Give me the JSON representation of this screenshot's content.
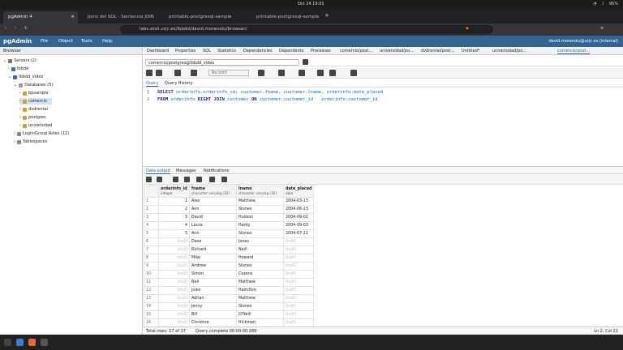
{
  "system": {
    "clock": "Oct 24  19:01",
    "battery": "95%"
  },
  "browser_tabs": [
    {
      "title": "pgAdmin 4",
      "active": true
    },
    {
      "title": "Joins del SQL - Sentencia JOIN",
      "active": false
    },
    {
      "title": "printable-postgresql-sample",
      "active": false
    },
    {
      "title": "printable-postgresql-sample",
      "active": false
    }
  ],
  "address": {
    "url": "labs.etsii.urjc.es/lbbdd/david.morenolu/browser/"
  },
  "app": {
    "logo": "pgAdmin",
    "menu": [
      "File",
      "Object",
      "Tools",
      "Help"
    ],
    "user": "david.morenolu@urjc.es (internal)"
  },
  "browser_panel": {
    "title": "Browser",
    "tree": [
      {
        "label": "Servers (2)",
        "level": 0
      },
      {
        "label": "lbbdd",
        "level": 1
      },
      {
        "label": "lbbdd_video",
        "level": 1
      },
      {
        "label": "Databases (5)",
        "level": 2
      },
      {
        "label": "bpsample",
        "level": 3
      },
      {
        "label": "comercio",
        "level": 3,
        "selected": true
      },
      {
        "label": "dvdrental",
        "level": 3
      },
      {
        "label": "postgres",
        "level": 3
      },
      {
        "label": "universidad",
        "level": 3
      },
      {
        "label": "Login/Group Roles (12)",
        "level": 2
      },
      {
        "label": "Tablespaces",
        "level": 2
      }
    ]
  },
  "panel_tabs": [
    "Dashboard",
    "Properties",
    "SQL",
    "Statistics",
    "Dependencies",
    "Dependents",
    "Processes",
    "comercio/post...",
    "universidad/po...",
    "dvdrental/post...",
    "Untitled*",
    "universidad/po...",
    "comercio/post..."
  ],
  "connection": "comercio/postgres@lbbdd_video",
  "toolbar": {
    "limit": "No limit"
  },
  "query_tabs": [
    "Query",
    "Query History"
  ],
  "editor": {
    "line1": {
      "num": "1",
      "kw1": "SELECT",
      "rest": " orderinfo.orderinfo_id, customer.fname, customer.lname, orderinfo.date_placed"
    },
    "line2": {
      "num": "2",
      "kw1": "FROM",
      "t1": " orderinfo ",
      "kw2": "RIGHT JOIN",
      "t2": " customer ",
      "kw3": "ON",
      "t3": " customer.customer_id   orderinfo.customer_id"
    }
  },
  "output_tabs": [
    "Data output",
    "Messages",
    "Notifications"
  ],
  "grid": {
    "columns": [
      {
        "name": "orderinfo_id",
        "type": "integer"
      },
      {
        "name": "fname",
        "type": "character varying (32)"
      },
      {
        "name": "lname",
        "type": "character varying (32)"
      },
      {
        "name": "date_placed",
        "type": "date"
      }
    ],
    "rows": [
      [
        "1",
        "1",
        "Alex",
        "Matthew",
        "2004-03-13"
      ],
      [
        "2",
        "2",
        "Ann",
        "Stones",
        "2004-06-23"
      ],
      [
        "3",
        "3",
        "David",
        "Hudson",
        "2004-09-02"
      ],
      [
        "4",
        "4",
        "Laura",
        "Hardy",
        "2004-09-03"
      ],
      [
        "5",
        "5",
        "Ann",
        "Stones",
        "2004-07-21"
      ],
      [
        "6",
        "[null]",
        "Dave",
        "Jones",
        "[null]"
      ],
      [
        "7",
        "[null]",
        "Richard",
        "Neill",
        "[null]"
      ],
      [
        "8",
        "[null]",
        "Mike",
        "Howard",
        "[null]"
      ],
      [
        "9",
        "[null]",
        "Andrew",
        "Stones",
        "[null]"
      ],
      [
        "10",
        "[null]",
        "Simon",
        "Cozens",
        "[null]"
      ],
      [
        "11",
        "[null]",
        "Neil",
        "Matthew",
        "[null]"
      ],
      [
        "12",
        "[null]",
        "Jules",
        "Hamilton",
        "[null]"
      ],
      [
        "13",
        "[null]",
        "Adrian",
        "Matthew",
        "[null]"
      ],
      [
        "14",
        "[null]",
        "Jenny",
        "Stones",
        "[null]"
      ],
      [
        "15",
        "[null]",
        "Bill",
        "O'Neill",
        "[null]"
      ],
      [
        "16",
        "[null]",
        "Christine",
        "Hickman",
        "[null]"
      ]
    ]
  },
  "status": {
    "total": "Total rows: 17 of 17",
    "time": "Query complete 00:00:00.289",
    "pos": "Ln 2, Col 21"
  }
}
